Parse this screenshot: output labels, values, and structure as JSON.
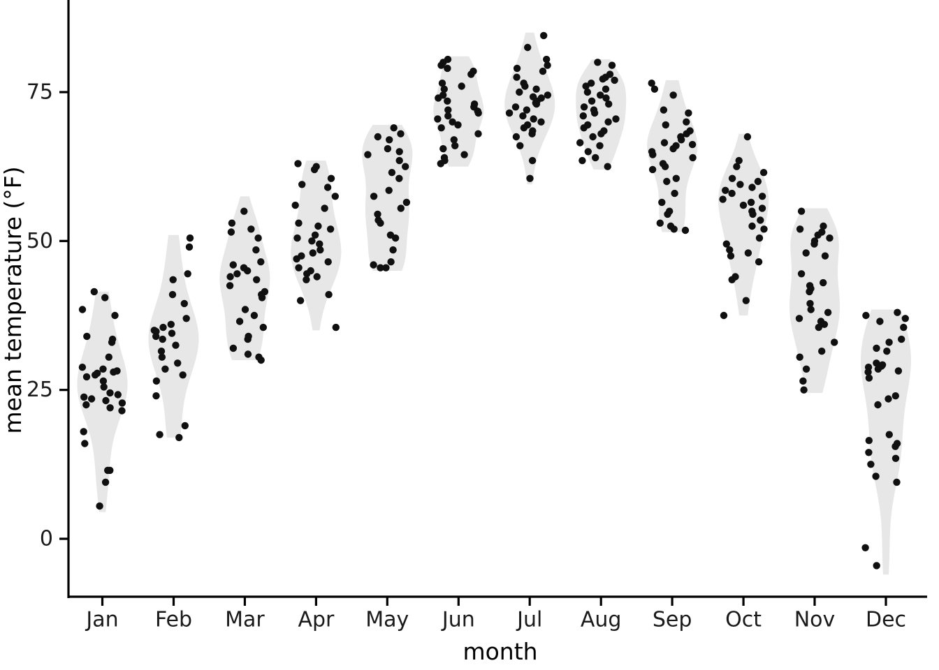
{
  "chart_data": {
    "type": "violin",
    "title": "",
    "subtitle": "",
    "xlabel": "month",
    "ylabel": "mean temperature (°F)",
    "categories": [
      "Jan",
      "Feb",
      "Mar",
      "Apr",
      "May",
      "Jun",
      "Jul",
      "Aug",
      "Sep",
      "Oct",
      "Nov",
      "Dec"
    ],
    "x_tick_labels": [
      "Jan",
      "Feb",
      "Mar",
      "Apr",
      "May",
      "Jun",
      "Jul",
      "Aug",
      "Sep",
      "Oct",
      "Nov",
      "Dec"
    ],
    "y_tick_labels": [
      "0",
      "25",
      "50",
      "75"
    ],
    "y_ticks": [
      0,
      25,
      50,
      75
    ],
    "ylim": [
      -9,
      89
    ],
    "grid": false,
    "legend": "none",
    "point_overlay": "jittered points",
    "violin_fill": "#e7e7e7",
    "point_color": "#101010",
    "background": "#ffffff",
    "axis_color": "#000000",
    "series": [
      {
        "name": "Jan",
        "values": [
          41.5,
          40.5,
          38.5,
          37.5,
          34.0,
          33.5,
          33.0,
          30.5,
          28.8,
          28.5,
          28.2,
          28.0,
          27.8,
          27.5,
          27.2,
          26.5,
          25.5,
          24.5,
          24.2,
          23.8,
          23.5,
          23.2,
          22.8,
          22.5,
          22.0,
          21.5,
          18.0,
          16.0,
          11.5,
          11.5,
          9.5,
          5.5
        ],
        "violin_min": 4.5,
        "violin_max": 41.5
      },
      {
        "name": "Feb",
        "values": [
          50.5,
          49.0,
          44.5,
          43.5,
          41.0,
          39.5,
          37.0,
          36.0,
          35.5,
          35.0,
          34.8,
          34.5,
          34.0,
          33.5,
          32.5,
          31.5,
          30.5,
          29.5,
          28.5,
          27.5,
          26.5,
          24.0,
          19.0,
          17.5,
          17.0
        ],
        "violin_min": 17.0,
        "violin_max": 51.0
      },
      {
        "name": "Mar",
        "values": [
          55.0,
          53.0,
          52.0,
          51.5,
          50.5,
          48.5,
          46.5,
          46.0,
          45.5,
          45.0,
          44.5,
          44.0,
          43.5,
          42.5,
          41.5,
          41.0,
          40.5,
          38.5,
          37.5,
          36.5,
          35.5,
          34.0,
          33.5,
          32.0,
          31.0,
          30.5,
          30.0
        ],
        "violin_min": 30.0,
        "violin_max": 57.5
      },
      {
        "name": "Apr",
        "values": [
          63.0,
          62.5,
          62.0,
          60.5,
          59.5,
          59.0,
          57.5,
          56.0,
          55.5,
          53.0,
          52.5,
          52.0,
          51.0,
          50.5,
          50.0,
          49.5,
          48.5,
          48.0,
          47.5,
          47.0,
          46.5,
          45.5,
          45.0,
          44.5,
          44.0,
          43.5,
          41.0,
          40.0,
          35.5
        ],
        "violin_min": 35.0,
        "violin_max": 63.5
      },
      {
        "name": "May",
        "values": [
          69.0,
          68.0,
          67.5,
          67.0,
          65.5,
          65.0,
          64.5,
          63.5,
          62.5,
          61.5,
          60.5,
          58.5,
          57.5,
          56.5,
          55.5,
          54.5,
          53.5,
          53.0,
          51.0,
          50.5,
          48.5,
          46.5,
          46.0,
          45.5,
          45.5
        ],
        "violin_min": 45.0,
        "violin_max": 69.5
      },
      {
        "name": "Jun",
        "values": [
          80.5,
          80.0,
          79.5,
          79.0,
          78.5,
          78.0,
          76.5,
          76.0,
          75.5,
          74.5,
          74.0,
          73.5,
          73.0,
          72.5,
          72.0,
          71.8,
          71.5,
          71.0,
          70.5,
          70.0,
          69.5,
          69.0,
          68.0,
          67.0,
          66.0,
          65.5,
          64.5,
          64.0,
          63.5,
          63.0
        ],
        "violin_min": 62.5,
        "violin_max": 81.0
      },
      {
        "name": "Jul",
        "values": [
          84.5,
          82.5,
          80.5,
          79.5,
          79.0,
          78.5,
          77.5,
          76.5,
          76.0,
          75.5,
          75.0,
          74.5,
          74.2,
          74.0,
          73.5,
          73.2,
          73.0,
          72.5,
          72.0,
          71.5,
          71.0,
          70.5,
          70.0,
          69.5,
          69.0,
          68.5,
          68.0,
          67.5,
          66.0,
          63.5,
          60.5
        ],
        "violin_min": 59.5,
        "violin_max": 85.0
      },
      {
        "name": "Aug",
        "values": [
          80.0,
          79.5,
          78.0,
          77.5,
          77.2,
          77.0,
          76.5,
          76.0,
          75.5,
          75.0,
          74.5,
          74.0,
          73.5,
          73.0,
          72.5,
          72.0,
          71.5,
          71.0,
          70.5,
          70.0,
          69.5,
          69.0,
          68.5,
          68.0,
          67.5,
          66.5,
          66.0,
          65.0,
          64.0,
          63.5,
          62.5
        ],
        "violin_min": 62.0,
        "violin_max": 80.5
      },
      {
        "name": "Sep",
        "values": [
          76.5,
          75.5,
          74.5,
          72.0,
          71.5,
          70.0,
          69.5,
          68.5,
          68.0,
          67.5,
          67.0,
          66.5,
          66.2,
          66.0,
          65.5,
          65.0,
          64.5,
          64.0,
          63.0,
          62.5,
          62.0,
          60.5,
          60.0,
          58.0,
          56.5,
          55.0,
          54.5,
          53.0,
          52.5,
          52.0,
          51.8
        ],
        "violin_min": 51.5,
        "violin_max": 77.0
      },
      {
        "name": "Oct",
        "values": [
          67.5,
          63.5,
          62.5,
          61.5,
          60.5,
          60.0,
          59.5,
          59.0,
          58.5,
          58.0,
          57.5,
          57.0,
          56.5,
          56.0,
          55.5,
          55.0,
          54.5,
          53.5,
          52.5,
          52.0,
          50.5,
          49.5,
          48.5,
          48.0,
          47.5,
          46.5,
          44.0,
          43.5,
          40.0,
          37.5
        ],
        "violin_min": 37.5,
        "violin_max": 68.0
      },
      {
        "name": "Nov",
        "values": [
          55.0,
          52.5,
          52.0,
          51.5,
          51.0,
          50.5,
          50.0,
          49.5,
          48.0,
          47.5,
          44.5,
          43.0,
          42.5,
          42.0,
          41.5,
          39.5,
          38.5,
          38.0,
          37.0,
          36.5,
          36.0,
          35.5,
          33.0,
          31.5,
          30.5,
          28.5,
          26.5,
          25.0
        ],
        "violin_min": 24.5,
        "violin_max": 55.5
      },
      {
        "name": "Dec",
        "values": [
          38.0,
          37.5,
          37.0,
          36.5,
          35.5,
          33.5,
          33.0,
          32.0,
          31.5,
          29.5,
          29.2,
          29.0,
          28.8,
          28.5,
          28.2,
          28.0,
          27.0,
          24.0,
          23.5,
          22.5,
          17.5,
          16.5,
          16.0,
          15.5,
          14.5,
          13.5,
          12.5,
          10.5,
          9.5,
          -1.5,
          -4.5
        ],
        "violin_min": -6.0,
        "violin_max": 38.5
      }
    ]
  }
}
